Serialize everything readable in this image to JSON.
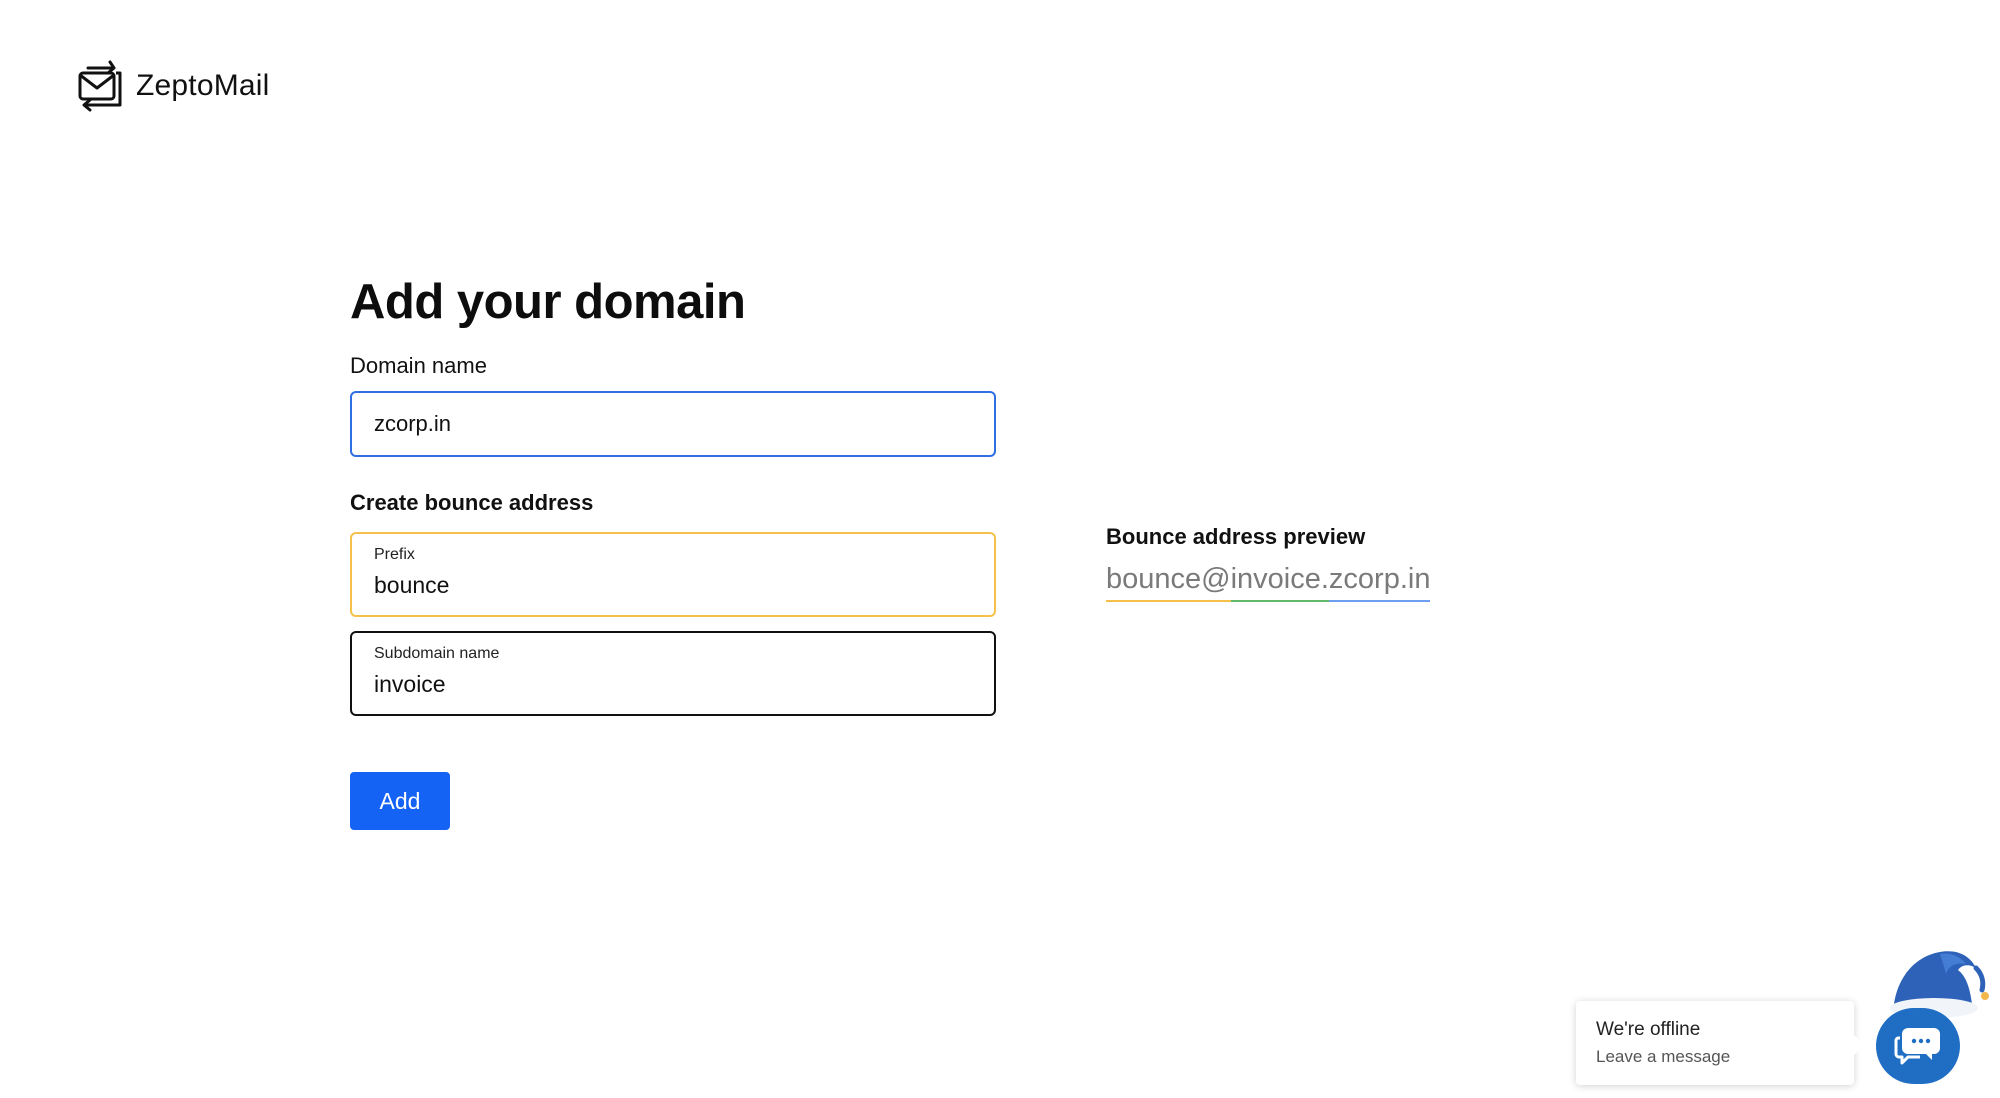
{
  "brand": {
    "name": "ZeptoMail",
    "logo_icon": "envelope-arrows-icon"
  },
  "page": {
    "title": "Add your domain"
  },
  "form": {
    "domain_label": "Domain name",
    "domain_value": "zcorp.in",
    "bounce_section_label": "Create bounce address",
    "prefix_label": "Prefix",
    "prefix_value": "bounce",
    "subdomain_label": "Subdomain name",
    "subdomain_value": "invoice",
    "add_label": "Add"
  },
  "preview": {
    "title": "Bounce address preview",
    "prefix_part": "bounce@",
    "subdomain_part": "invoice.",
    "domain_part": "zcorp.in"
  },
  "chat": {
    "status": "We're offline",
    "action": "Leave a message",
    "launcher_icon": "chat-bubble-icon",
    "decoration_icon": "santa-hat-icon"
  },
  "colors": {
    "primary": "#1463f5",
    "prefix_accent": "#f5c14b",
    "subdomain_accent": "#63b86b",
    "domain_accent": "#6d9ef0",
    "focus_border": "#2f6fe4",
    "chat_blue": "#1f6ec4"
  }
}
